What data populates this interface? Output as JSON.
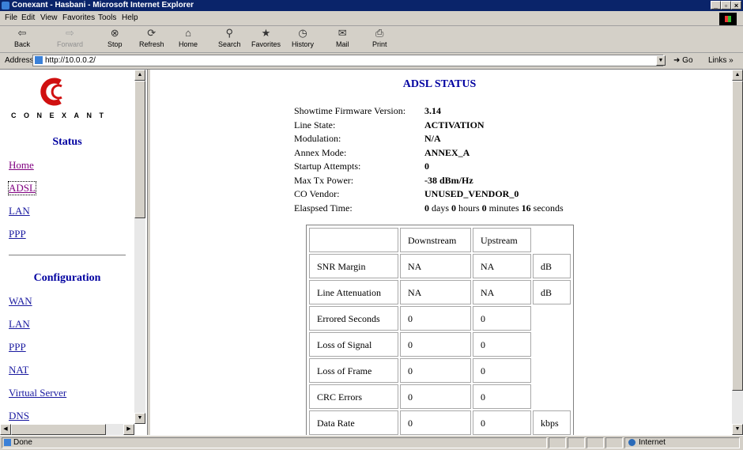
{
  "window": {
    "title": "Conexant - Hasbani - Microsoft Internet Explorer",
    "buttons": [
      "_",
      "▫",
      "×"
    ]
  },
  "menu": [
    "File",
    "Edit",
    "View",
    "Favorites",
    "Tools",
    "Help"
  ],
  "toolbar": {
    "back": "Back",
    "forward": "Forward",
    "stop": "Stop",
    "refresh": "Refresh",
    "home": "Home",
    "search": "Search",
    "favorites": "Favorites",
    "history": "History",
    "mail": "Mail",
    "print": "Print"
  },
  "address": {
    "label": "Address",
    "url": "http://10.0.0.2/",
    "go": "Go",
    "links": "Links »"
  },
  "sidebar": {
    "logo_text": "CONEXANT",
    "status_heading": "Status",
    "status_links": [
      "Home",
      "ADSL",
      "LAN",
      "PPP"
    ],
    "config_heading": "Configuration",
    "config_links": [
      "WAN",
      "LAN",
      "PPP",
      "NAT",
      "Virtual Server",
      "DNS"
    ]
  },
  "adsl": {
    "title": "ADSL STATUS",
    "labels": {
      "firmware": "Showtime Firmware Version:",
      "line_state": "Line State:",
      "modulation": "Modulation:",
      "annex": "Annex Mode:",
      "startup": "Startup Attempts:",
      "max_tx": "Max Tx Power:",
      "co_vendor": "CO Vendor:",
      "elapsed": "Elaspsed Time:"
    },
    "values": {
      "firmware": "3.14",
      "line_state": "ACTIVATION",
      "modulation": "N/A",
      "annex": "ANNEX_A",
      "startup": "0",
      "max_tx": "-38 dBm/Hz",
      "co_vendor": "UNUSED_VENDOR_0"
    },
    "elapsed": {
      "days": "0",
      "days_unit": "days",
      "hours": "0",
      "hours_unit": "hours",
      "minutes": "0",
      "minutes_unit": "minutes",
      "seconds": "16",
      "seconds_unit": "seconds"
    }
  },
  "table": {
    "headers": [
      "Downstream",
      "Upstream"
    ],
    "rows": [
      {
        "label": "SNR Margin",
        "down": "NA",
        "up": "NA",
        "unit": "dB"
      },
      {
        "label": "Line Attenuation",
        "down": "NA",
        "up": "NA",
        "unit": "dB"
      },
      {
        "label": "Errored Seconds",
        "down": "0",
        "up": "0",
        "unit": ""
      },
      {
        "label": "Loss of Signal",
        "down": "0",
        "up": "0",
        "unit": ""
      },
      {
        "label": "Loss of Frame",
        "down": "0",
        "up": "0",
        "unit": ""
      },
      {
        "label": "CRC Errors",
        "down": "0",
        "up": "0",
        "unit": ""
      },
      {
        "label": "Data Rate",
        "down": "0",
        "up": "0",
        "unit": "kbps"
      }
    ]
  },
  "status": {
    "left": "Done",
    "zone": "Internet"
  }
}
